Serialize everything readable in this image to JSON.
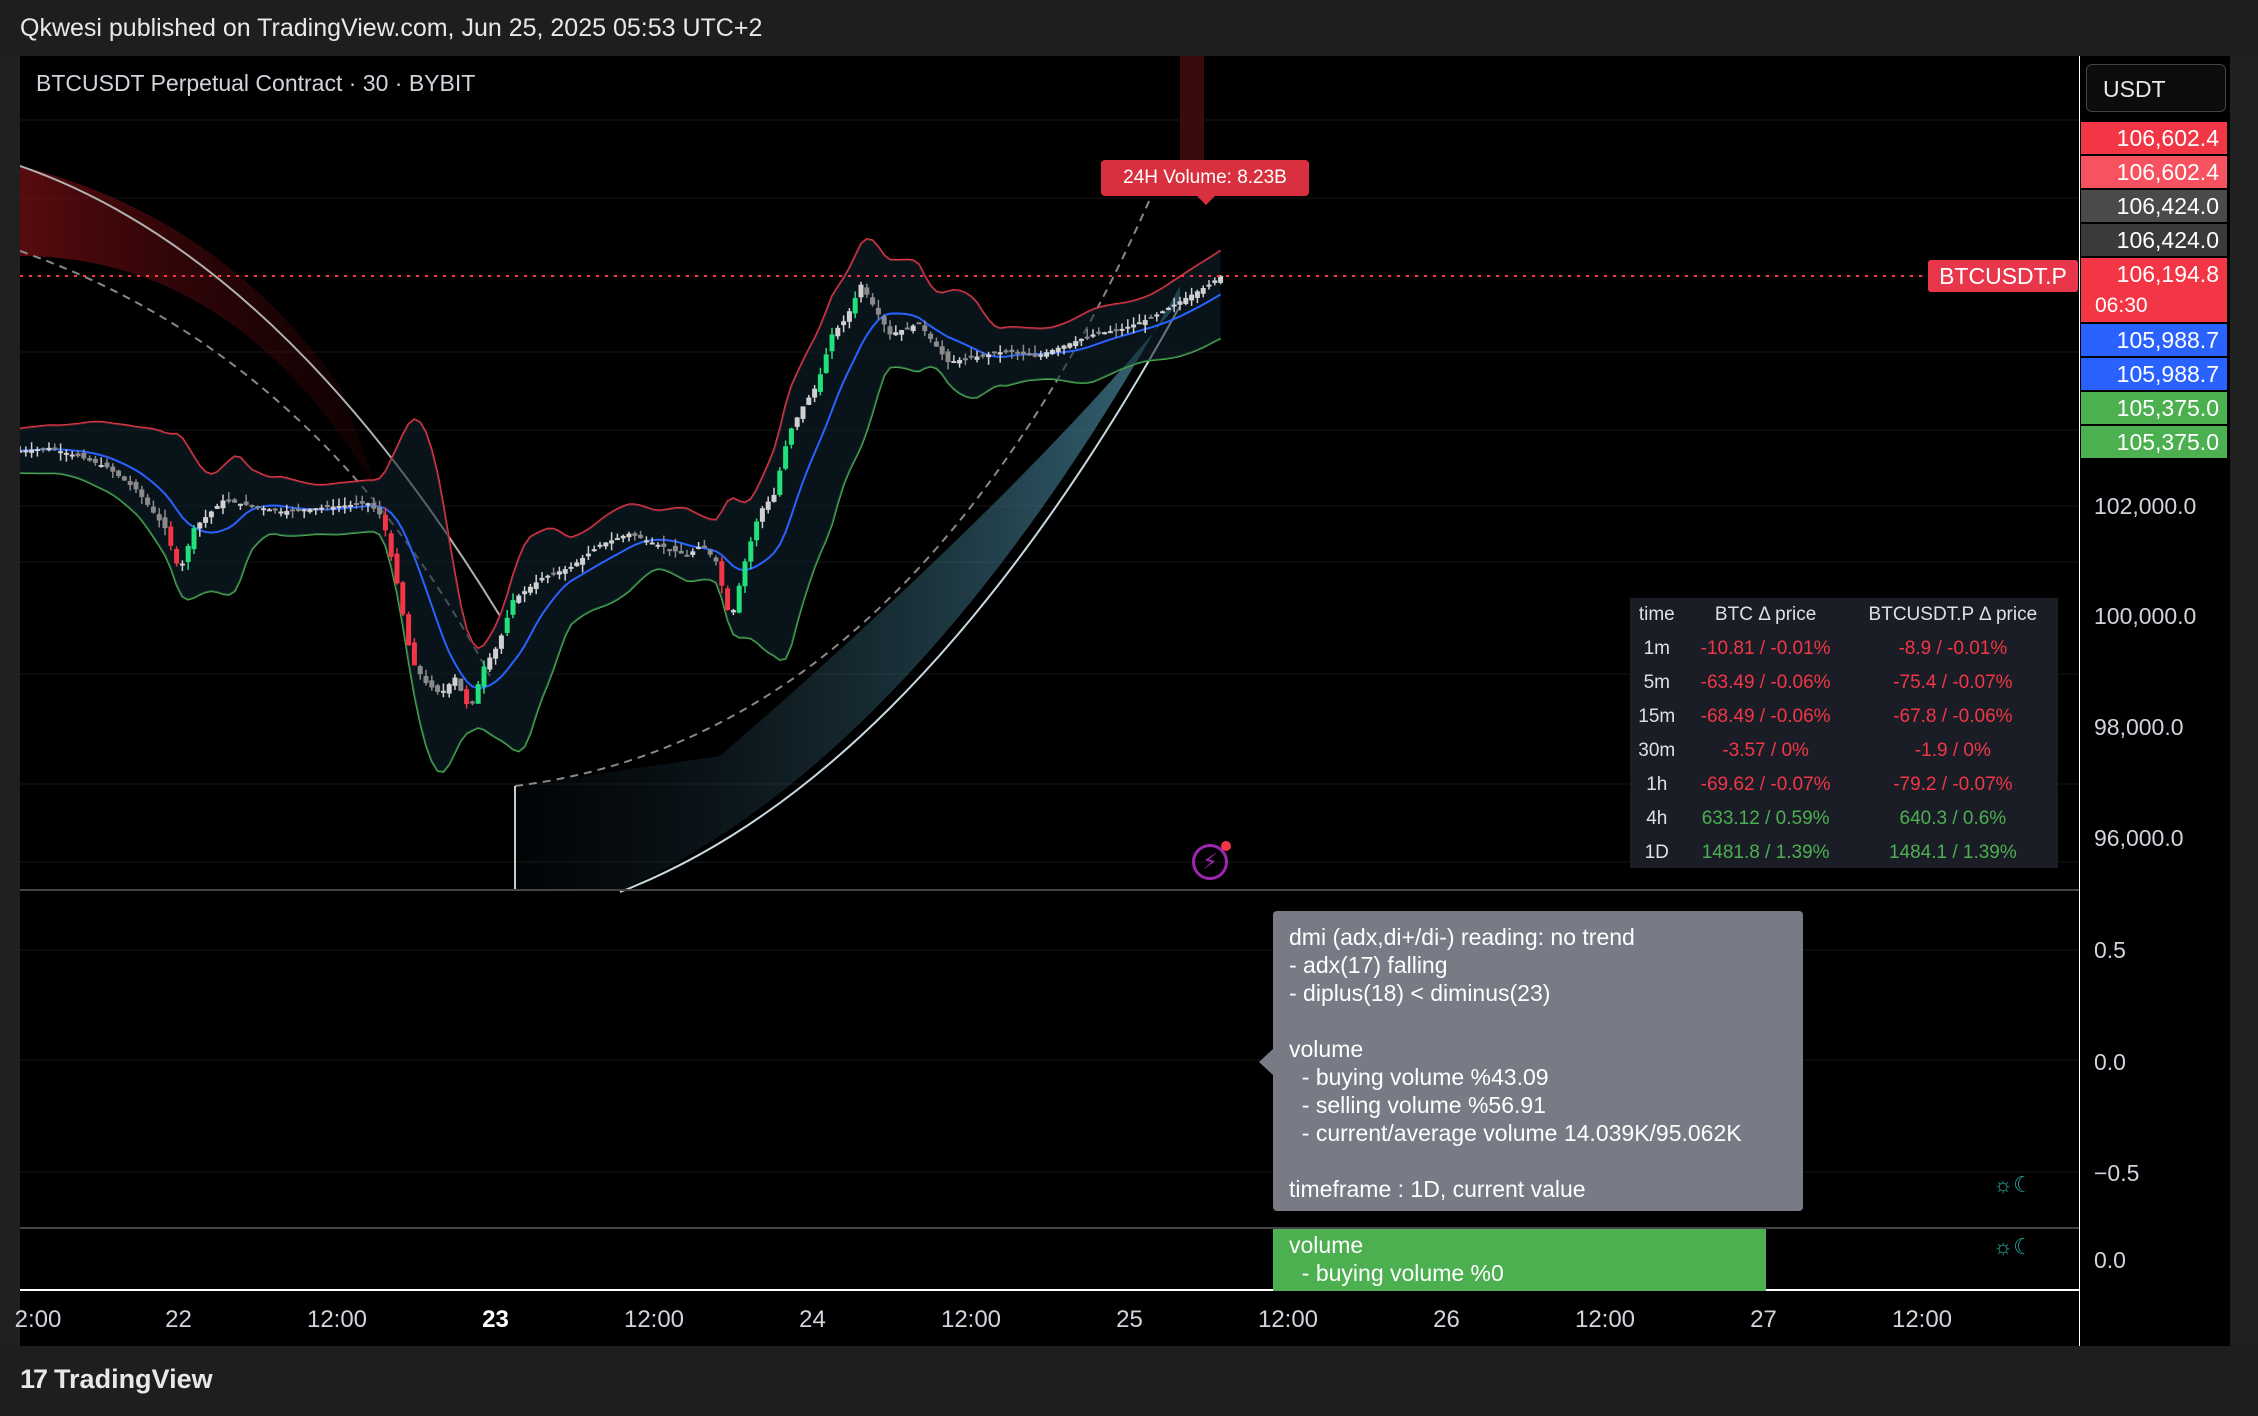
{
  "header": {
    "published": "Qkwesi published on TradingView.com, Jun 25, 2025 05:53 UTC+2"
  },
  "symbol_title": "BTCUSDT Perpetual Contract · 30 · BYBIT",
  "currency": "USDT",
  "volume_24h": "24H Volume: 8.23B",
  "symbol_flag": "BTCUSDT.P",
  "price_labels": [
    {
      "text": "106,602.4",
      "color": "#f23645"
    },
    {
      "text": "106,602.4",
      "color": "#f7525f"
    },
    {
      "text": "106,424.0",
      "color": "#4a4a4a"
    },
    {
      "text": "106,424.0",
      "color": "#3a3a3a"
    },
    {
      "text": "106,194.8",
      "color": "#f23645"
    },
    {
      "text": "06:30",
      "color": "#f23645"
    },
    {
      "text": "105,988.7",
      "color": "#2962ff"
    },
    {
      "text": "105,988.7",
      "color": "#2962ff"
    },
    {
      "text": "105,375.0",
      "color": "#4caf50"
    },
    {
      "text": "105,375.0",
      "color": "#4caf50"
    }
  ],
  "chart_data": {
    "type": "candlestick",
    "symbol": "BTCUSDT.P",
    "timeframe": "30",
    "exchange": "BYBIT",
    "price_axis_ticks": [
      "102,000.0",
      "100,000.0",
      "98,000.0",
      "96,000.0"
    ],
    "last_price": 106194.8,
    "x_ticks": [
      {
        "label": "2:00",
        "bold": false
      },
      {
        "label": "22",
        "bold": false
      },
      {
        "label": "12:00",
        "bold": false
      },
      {
        "label": "23",
        "bold": true
      },
      {
        "label": "12:00",
        "bold": false
      },
      {
        "label": "24",
        "bold": false
      },
      {
        "label": "12:00",
        "bold": false
      },
      {
        "label": "25",
        "bold": false
      },
      {
        "label": "12:00",
        "bold": false
      },
      {
        "label": "26",
        "bold": false
      },
      {
        "label": "12:00",
        "bold": false
      },
      {
        "label": "27",
        "bold": false
      },
      {
        "label": "12:00",
        "bold": false
      }
    ],
    "close_path": [
      [
        0,
        103000
      ],
      [
        10,
        103050
      ],
      [
        20,
        102900
      ],
      [
        30,
        102700
      ],
      [
        40,
        102300
      ],
      [
        50,
        101600
      ],
      [
        55,
        100800
      ],
      [
        60,
        101600
      ],
      [
        70,
        102100
      ],
      [
        80,
        102000
      ],
      [
        90,
        101900
      ],
      [
        100,
        101950
      ],
      [
        110,
        102000
      ],
      [
        120,
        102050
      ],
      [
        125,
        101800
      ],
      [
        130,
        100600
      ],
      [
        135,
        99200
      ],
      [
        140,
        98800
      ],
      [
        145,
        98600
      ],
      [
        150,
        98900
      ],
      [
        155,
        98300
      ],
      [
        160,
        99100
      ],
      [
        165,
        99500
      ],
      [
        170,
        100300
      ],
      [
        180,
        100700
      ],
      [
        190,
        100900
      ],
      [
        200,
        101300
      ],
      [
        210,
        101500
      ],
      [
        220,
        101300
      ],
      [
        230,
        101100
      ],
      [
        235,
        101300
      ],
      [
        240,
        101000
      ],
      [
        245,
        99900
      ],
      [
        250,
        101000
      ],
      [
        255,
        101900
      ],
      [
        260,
        102200
      ],
      [
        265,
        103300
      ],
      [
        270,
        103800
      ],
      [
        275,
        104200
      ],
      [
        280,
        105100
      ],
      [
        285,
        105400
      ],
      [
        290,
        106000
      ],
      [
        300,
        105100
      ],
      [
        310,
        105300
      ],
      [
        320,
        104600
      ],
      [
        330,
        104700
      ],
      [
        340,
        104800
      ],
      [
        350,
        104700
      ],
      [
        360,
        104900
      ],
      [
        370,
        105100
      ],
      [
        380,
        105200
      ],
      [
        390,
        105400
      ],
      [
        400,
        105700
      ],
      [
        410,
        106000
      ],
      [
        415,
        106194.8
      ]
    ],
    "delta_table": {
      "headers": [
        "time",
        "BTC Δ price",
        "BTCUSDT.P Δ price"
      ],
      "rows": [
        [
          "1m",
          "-10.81 / -0.01%",
          "-8.9 / -0.01%",
          "neg"
        ],
        [
          "5m",
          "-63.49 / -0.06%",
          "-75.4 / -0.07%",
          "neg"
        ],
        [
          "15m",
          "-68.49 / -0.06%",
          "-67.8 / -0.06%",
          "neg"
        ],
        [
          "30m",
          "-3.57 / 0%",
          "-1.9 / 0%",
          "neg"
        ],
        [
          "1h",
          "-69.62 / -0.07%",
          "-79.2 / -0.07%",
          "neg"
        ],
        [
          "4h",
          "633.12 / 0.59%",
          "640.3 / 0.6%",
          "pos"
        ],
        [
          "1D",
          "1481.8 / 1.39%",
          "1484.1 / 1.39%",
          "pos"
        ]
      ]
    },
    "indicator_axis_ticks": [
      "0.5",
      "0.0",
      "−0.5",
      "0.0"
    ]
  },
  "tooltip_main": "dmi (adx,di+/di-) reading: no trend\n- adx(17) falling\n- diplus(18) < diminus(23)\n\nvolume\n  - buying volume %43.09\n  - selling volume %56.91\n  - current/average volume 14.039K/95.062K\n\ntimeframe : 1D, current value",
  "tooltip_secondary": "volume\n  - buying volume %0",
  "footer": {
    "brand": "TradingView"
  },
  "colors": {
    "bull": "#22e07a",
    "bear": "#f23645",
    "upper_band": "#f23645",
    "lower_band": "#4caf50",
    "mid_line": "#2962ff"
  }
}
